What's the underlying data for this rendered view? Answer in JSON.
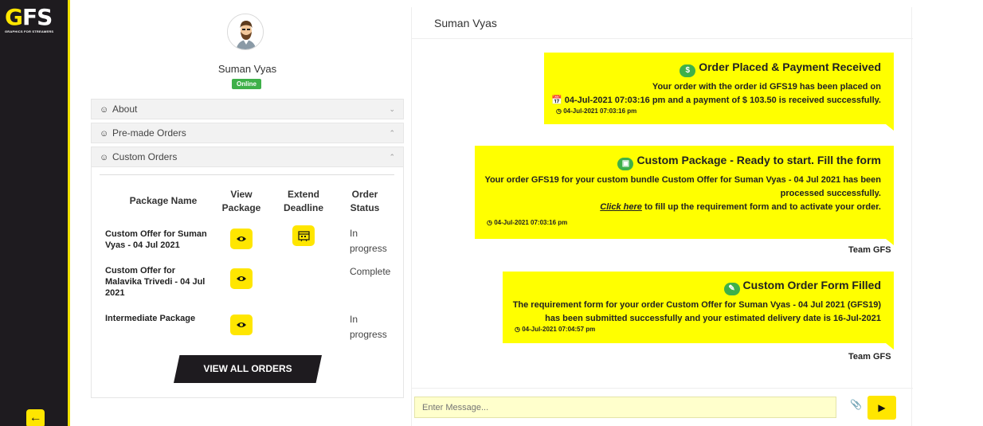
{
  "brand": {
    "logo_text": "GFS",
    "logo_subtitle": "GRAPHICS FOR STREAMERS"
  },
  "nav": {
    "back_icon": "arrow-left-icon"
  },
  "profile": {
    "name": "Suman Vyas",
    "status": "Online"
  },
  "accordion": {
    "sections": [
      {
        "label": "About",
        "expanded": false
      },
      {
        "label": "Pre-made Orders",
        "expanded": false
      },
      {
        "label": "Custom Orders",
        "expanded": true
      }
    ]
  },
  "orders": {
    "headers": {
      "package_name": "Package Name",
      "view_package_1": "View",
      "view_package_2": "Package",
      "extend_deadline_1": "Extend",
      "extend_deadline_2": "Deadline",
      "order_status_1": "Order",
      "order_status_2": "Status"
    },
    "rows": [
      {
        "name_1": "Custom Offer for Suman",
        "name_2": "Vyas - 04 Jul 2021",
        "name_3": "",
        "status_1": "In",
        "status_2": "progress",
        "extend": true
      },
      {
        "name_1": "Custom Offer for",
        "name_2": "Malavika Trivedi - 04 Jul",
        "name_3": "2021",
        "status_1": "Complete",
        "status_2": "",
        "extend": false
      },
      {
        "name_1": "Intermediate Package",
        "name_2": "",
        "name_3": "",
        "status_1": "In",
        "status_2": "progress",
        "extend": false
      }
    ],
    "view_all_label": "VIEW ALL ORDERS"
  },
  "chat": {
    "contact": "Suman Vyas",
    "messages": [
      {
        "title": "Order Placed & Payment Received",
        "line1": "Your order with the order id GFS19 has been placed on",
        "line2": "04-Jul-2021 07:03:16 pm and a payment of $ 103.50 is received successfully.",
        "time": "04-Jul-2021 07:03:16 pm"
      },
      {
        "title": "Custom Package - Ready to start. Fill the form",
        "line1": "Your order GFS19 for your custom bundle Custom Offer for Suman Vyas - 04 Jul 2021 has been",
        "line2": "processed successfully.",
        "link": "Click here",
        "line3": " to fill up the requirement form and to activate your order.",
        "time": "04-Jul-2021 07:03:16 pm",
        "sender": "Team GFS"
      },
      {
        "title": "Custom Order Form Filled",
        "line1": "The requirement form for your order Custom Offer for Suman Vyas - 04 Jul 2021 (GFS19)",
        "line2": "has been submitted successfully and your estimated delivery date is 16-Jul-2021",
        "time": "04-Jul-2021 07:04:57 pm",
        "sender": "Team GFS"
      }
    ],
    "input_placeholder": "Enter Message..."
  },
  "colors": {
    "accent": "#ffe600",
    "bubble": "#ffff00",
    "dark": "#1e1b1f",
    "online": "#3eb049"
  }
}
